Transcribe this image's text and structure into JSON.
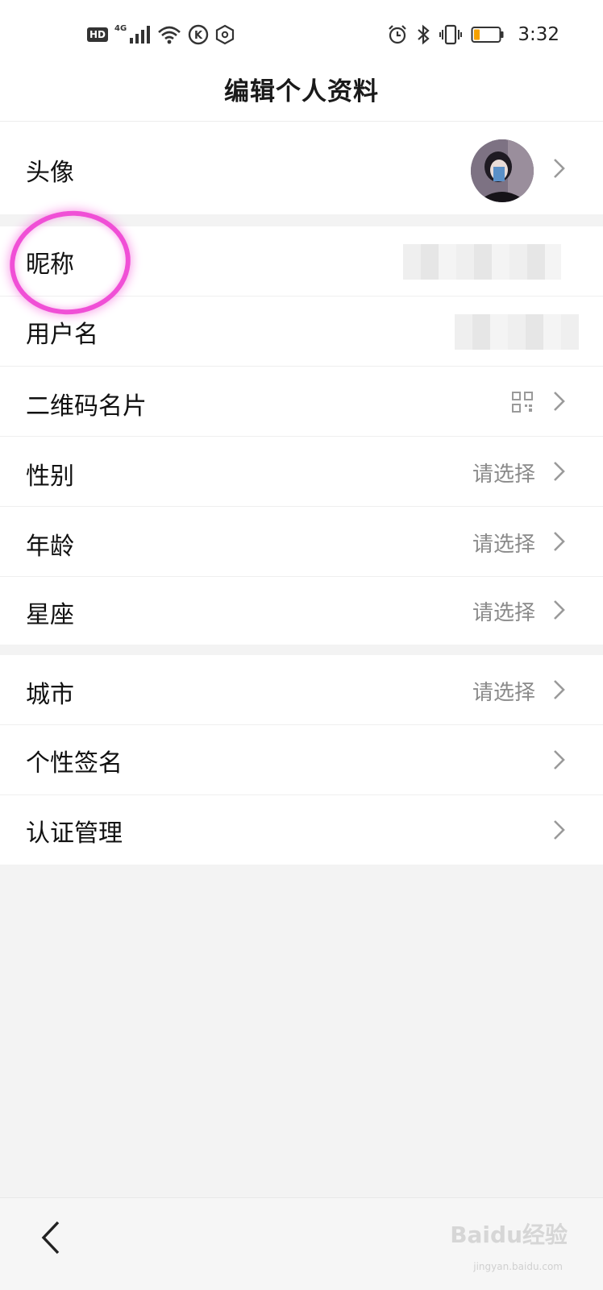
{
  "status_bar": {
    "hd": "HD",
    "signal_tag": "4G",
    "k_badge": "K",
    "time": "3:32"
  },
  "header": {
    "title": "编辑个人资料"
  },
  "rows": [
    {
      "label": "头像",
      "value": ""
    },
    {
      "label": "昵称",
      "value": ""
    },
    {
      "label": "用户名",
      "value": ""
    },
    {
      "label": "二维码名片",
      "value": ""
    },
    {
      "label": "性别",
      "value": "请选择"
    },
    {
      "label": "年龄",
      "value": "请选择"
    },
    {
      "label": "星座",
      "value": "请选择"
    },
    {
      "label": "城市",
      "value": "请选择"
    },
    {
      "label": "个性签名",
      "value": ""
    },
    {
      "label": "认证管理",
      "value": ""
    }
  ],
  "icons": {
    "qr": "qr-code-icon",
    "chevron": "chevron-right-icon",
    "back": "back-icon"
  },
  "colors": {
    "highlight": "#f04fd6",
    "placeholder_text": "#8a8a8a",
    "battery_low": "#f5a100"
  },
  "watermark": {
    "brand": "Baidu经验",
    "url": "jingyan.baidu.com"
  }
}
